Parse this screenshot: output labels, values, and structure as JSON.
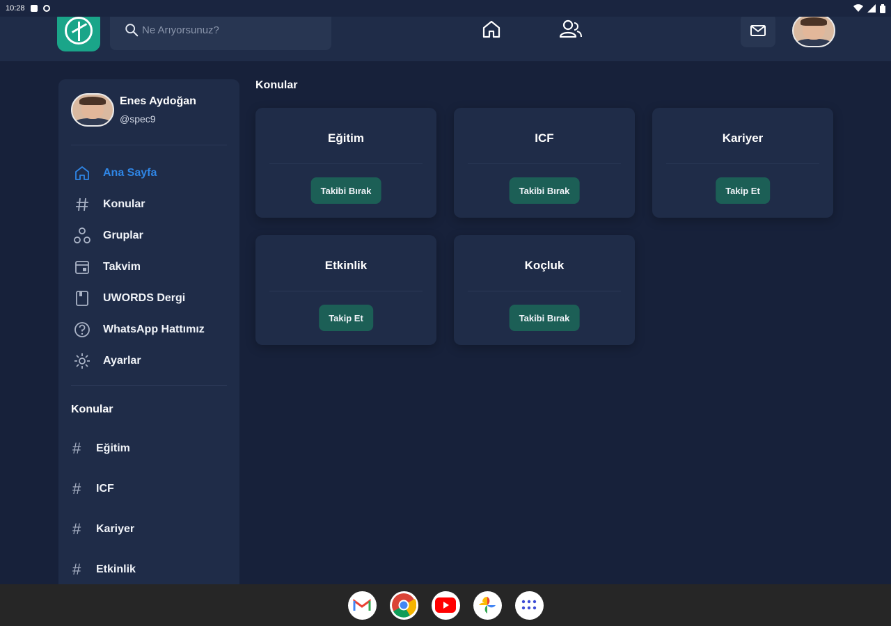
{
  "status_bar": {
    "time": "10:28"
  },
  "header": {
    "search_placeholder": "Ne Arıyorsunuz?",
    "nav": [
      "home-icon",
      "users-icon"
    ],
    "mail_icon": "mail-icon"
  },
  "sidebar": {
    "user": {
      "name": "Enes Aydoğan",
      "handle": "@spec9"
    },
    "menu": [
      {
        "label": "Ana Sayfa",
        "icon": "home-icon",
        "active": true
      },
      {
        "label": "Konular",
        "icon": "hash-icon"
      },
      {
        "label": "Gruplar",
        "icon": "groups-icon"
      },
      {
        "label": "Takvim",
        "icon": "calendar-icon"
      },
      {
        "label": "UWORDS Dergi",
        "icon": "book-icon"
      },
      {
        "label": "WhatsApp Hattımız",
        "icon": "help-icon"
      },
      {
        "label": "Ayarlar",
        "icon": "gear-icon"
      }
    ],
    "topics_title": "Konular",
    "topics": [
      "Eğitim",
      "ICF",
      "Kariyer",
      "Etkinlik"
    ]
  },
  "main": {
    "title": "Konular",
    "cards": [
      {
        "title": "Eğitim",
        "button": "Takibi Bırak"
      },
      {
        "title": "ICF",
        "button": "Takibi Bırak"
      },
      {
        "title": "Kariyer",
        "button": "Takip Et"
      },
      {
        "title": "Etkinlik",
        "button": "Takip Et"
      },
      {
        "title": "Koçluk",
        "button": "Takibi Bırak"
      }
    ]
  },
  "taskbar": [
    "gmail-icon",
    "chrome-icon",
    "youtube-icon",
    "photos-icon",
    "apps-icon"
  ],
  "colors": {
    "accent": "#2f86e6",
    "button_bg": "#1c5f56",
    "panel": "#1f2c48",
    "background": "#17213a",
    "brand": "#1aa589"
  }
}
